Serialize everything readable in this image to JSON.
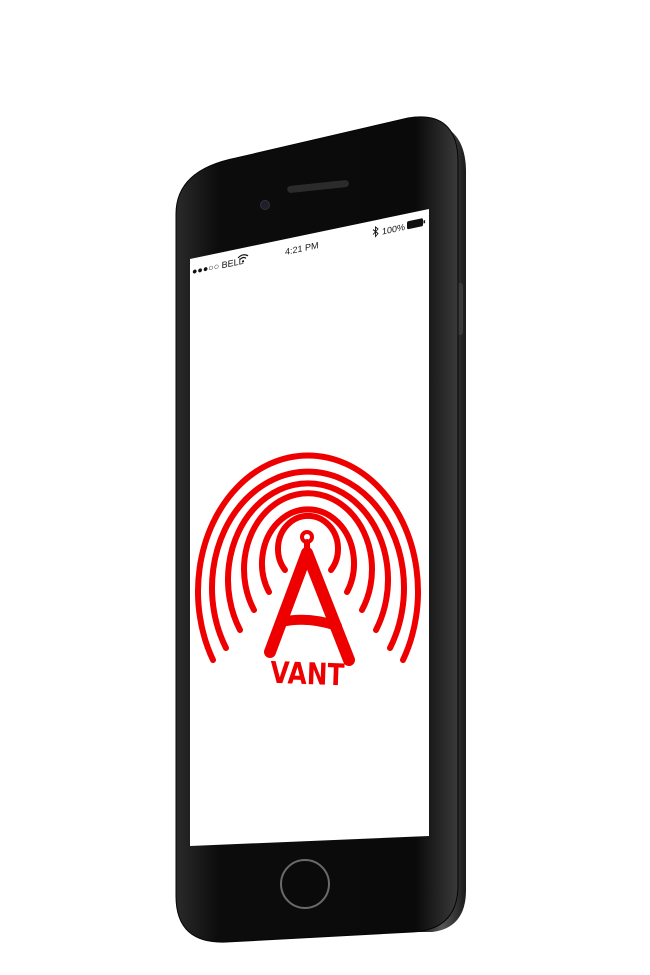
{
  "status_bar": {
    "carrier": "●●●○○ BELL",
    "time": "4:21 PM",
    "battery": "100%"
  },
  "logo": {
    "wordmark": "VANT",
    "color": "#ee0000"
  },
  "icons": {
    "wifi": "wifi-icon",
    "bluetooth": "bluetooth-icon",
    "battery": "battery-icon",
    "home": "home-button-icon",
    "camera": "front-camera-icon",
    "speaker": "earpiece-icon"
  }
}
